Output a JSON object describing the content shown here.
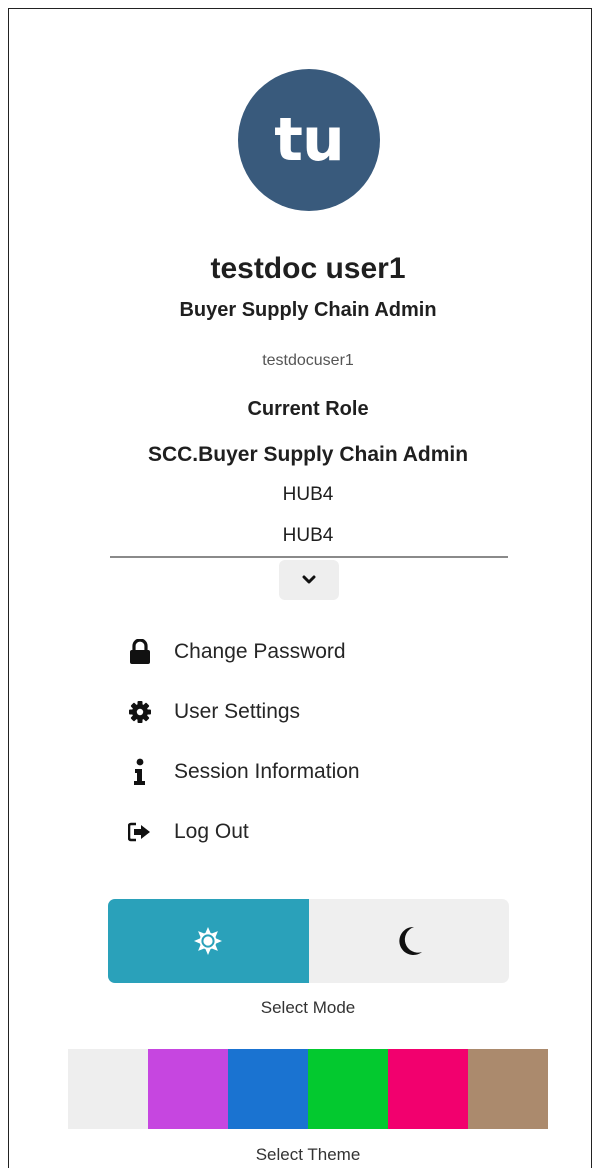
{
  "profile": {
    "initials": "tu",
    "name": "testdoc user1",
    "title": "Buyer Supply Chain Admin",
    "username": "testdocuser1",
    "avatar_color": "#395a7c"
  },
  "role": {
    "label": "Current Role",
    "value": "SCC.Buyer Supply Chain Admin",
    "org_1": "HUB4",
    "org_2": "HUB4",
    "expand_icon": "chevron-down-icon"
  },
  "menu": [
    {
      "label": "Change Password",
      "icon": "lock-icon"
    },
    {
      "label": "User Settings",
      "icon": "gear-icon"
    },
    {
      "label": "Session Information",
      "icon": "info-icon"
    },
    {
      "label": "Log Out",
      "icon": "sign-out-icon"
    }
  ],
  "mode": {
    "caption": "Select Mode",
    "options": [
      {
        "name": "light",
        "icon": "sun-icon",
        "active": true
      },
      {
        "name": "dark",
        "icon": "moon-icon",
        "active": false
      }
    ],
    "active_color": "#2aa1ba"
  },
  "theme": {
    "caption": "Select Theme",
    "swatches": [
      "#eeeeee",
      "#c646e0",
      "#1a73d1",
      "#03c92f",
      "#f2006e",
      "#ab8a6d"
    ]
  }
}
